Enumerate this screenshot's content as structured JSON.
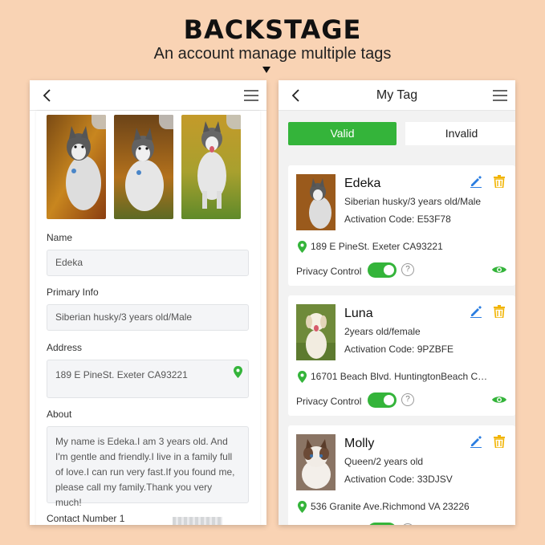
{
  "hero": {
    "title": "BACKSTAGE",
    "subtitle": "An account manage multiple tags"
  },
  "colors": {
    "background": "#f9d3b4",
    "accent_green": "#34b43a",
    "edit_blue": "#2a7de1",
    "trash_yellow": "#f2b400"
  },
  "left_phone": {
    "icons": {
      "back": "chevron-left-icon",
      "menu": "hamburger-menu-icon"
    },
    "photos": [
      "husky-photo-1",
      "husky-photo-2",
      "husky-photo-3"
    ],
    "form": {
      "name_label": "Name",
      "name_value": "Edeka",
      "primary_label": "Primary Info",
      "primary_value": "Siberian husky/3 years old/Male",
      "address_label": "Address",
      "address_value": "189 E PineSt. Exeter CA93221",
      "about_label": "About",
      "about_value": "My name is Edeka.I am 3 years old. And I'm gentle and friendly.I live in a family full of love.I can run very fast.If you found me, please call my family.Thank you very much!",
      "contact_label": "Contact Number 1"
    }
  },
  "right_phone": {
    "title": "My Tag",
    "tabs": {
      "valid": "Valid",
      "invalid": "Invalid"
    },
    "privacy_label": "Privacy Control",
    "help_glyph": "?",
    "cards": [
      {
        "name": "Edeka",
        "info": "Siberian husky/3 years old/Male",
        "code": "Activation Code: E53F78",
        "address": "189 E PineSt. Exeter CA93221"
      },
      {
        "name": "Luna",
        "info": "2years old/female",
        "code": "Activation Code: 9PZBFE",
        "address": "16701 Beach Blvd. HuntingtonBeach C…"
      },
      {
        "name": "Molly",
        "info": "Queen/2 years old",
        "code": "Activation Code: 33DJSV",
        "address": "536 Granite Ave.Richmond VA 23226"
      }
    ]
  }
}
